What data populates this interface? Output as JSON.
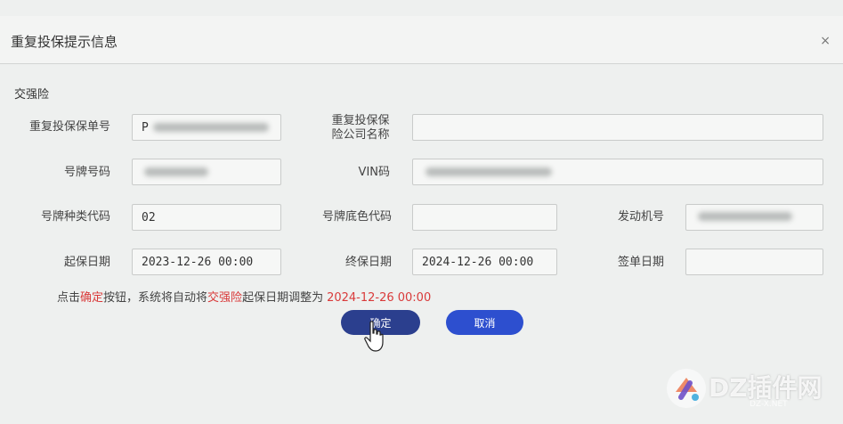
{
  "dialog": {
    "title": "重复投保提示信息",
    "close_glyph": "×"
  },
  "section_title": "交强险",
  "fields": {
    "policy_no_label": "重复投保保单号",
    "policy_no_value": "P",
    "insurer_label_line1": "重复投保保",
    "insurer_label_line2": "险公司名称",
    "insurer_value": "",
    "plate_label": "号牌号码",
    "plate_value": "",
    "vin_label": "VIN码",
    "vin_value": "",
    "plate_type_label": "号牌种类代码",
    "plate_type_value": "02",
    "plate_color_label": "号牌底色代码",
    "plate_color_value": "",
    "engine_label": "发动机号",
    "engine_value": "",
    "start_date_label": "起保日期",
    "start_date_value": "2023-12-26 00:00",
    "end_date_label": "终保日期",
    "end_date_value": "2024-12-26 00:00",
    "sign_date_label": "签单日期",
    "sign_date_value": ""
  },
  "notice": {
    "part1": "点击",
    "highlight1": "确定",
    "part2": "按钮，系统将自动将",
    "highlight2": "交强险",
    "part3": "起保日期调整为",
    "date": "2024-12-26 00:00"
  },
  "buttons": {
    "ok": "确定",
    "cancel": "取消"
  },
  "watermark": {
    "text": "DZ插件网",
    "sub": "DZ-X.NET"
  },
  "colors": {
    "highlight": "#d93a3a",
    "ok_button": "#2b3f8e",
    "cancel_button": "#2d4fcf"
  }
}
